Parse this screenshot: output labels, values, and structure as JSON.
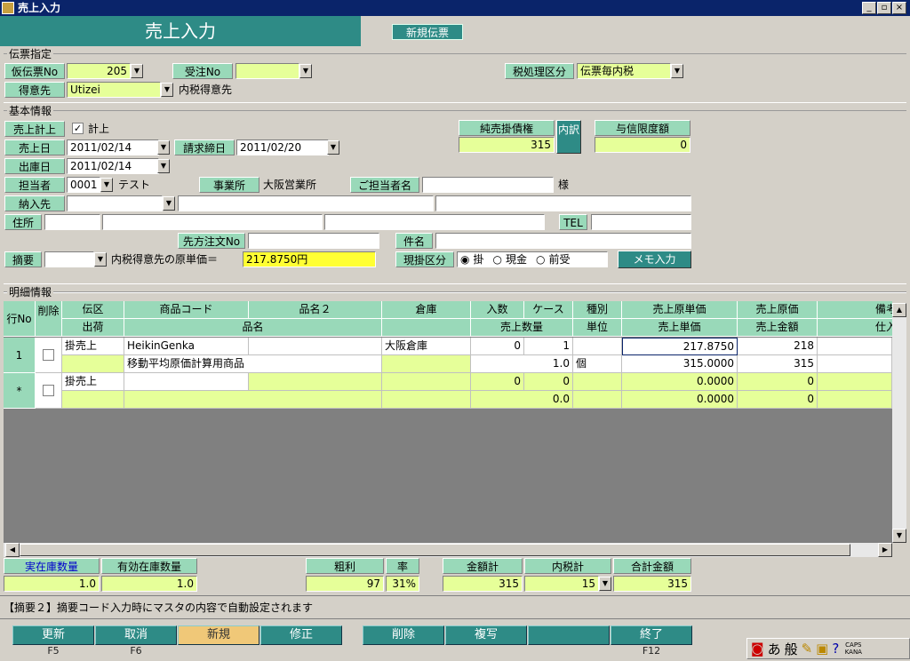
{
  "window": {
    "title": "売上入力"
  },
  "header": {
    "title": "売上入力",
    "badge": "新規伝票"
  },
  "denpyo": {
    "group_label": "伝票指定",
    "kari_no_label": "仮伝票No",
    "kari_no_value": "205",
    "juchu_no_label": "受注No",
    "juchu_no_value": "",
    "tax_label": "税処理区分",
    "tax_value": "伝票毎内税",
    "tokuisaki_label": "得意先",
    "tokuisaki_value": "Utizei",
    "tokuisaki_name": "内税得意先"
  },
  "kihon": {
    "group_label": "基本情報",
    "keijo_label": "売上計上",
    "keijo_check_label": "計上",
    "uriage_date_label": "売上日",
    "uriage_date": "2011/02/14",
    "seikyu_label": "請求締日",
    "seikyu_date": "2011/02/20",
    "shukko_label": "出庫日",
    "shukko_date": "2011/02/14",
    "tanto_label": "担当者",
    "tanto_code": "0001",
    "tanto_name": "テスト",
    "jigyosho_label": "事業所",
    "jigyosho_value": "大阪営業所",
    "gotanto_label": "ご担当者名",
    "gotanto_value": "",
    "sama": "様",
    "nonyu_label": "納入先",
    "jusho_label": "住所",
    "tel_label": "TEL",
    "sakichumon_label": "先方注文No",
    "kenmei_label": "件名",
    "tekiyo_label": "摘要",
    "tekiyo_text": "内税得意先の原単価＝",
    "tekiyo_value": "217.8750円",
    "genkake_label": "現掛区分",
    "radio_kake": "掛",
    "radio_genkin": "現金",
    "radio_maeuke": "前受",
    "memo_button": "メモ入力",
    "junuri_label": "純売掛債権",
    "junuri_value": "315",
    "uchiwake_button": "内訳",
    "yoshin_label": "与信限度額",
    "yoshin_value": "0"
  },
  "meisai": {
    "group_label": "明細情報",
    "headers_top": [
      "行No",
      "削除",
      "伝区",
      "商品コード",
      "品名２",
      "倉庫",
      "入数",
      "ケース",
      "種別",
      "売上原単価",
      "売上原価",
      "備考"
    ],
    "headers_bottom": [
      "出荷",
      "品名",
      "売上数量",
      "単位",
      "売上単価",
      "売上金額",
      "仕入"
    ],
    "rows": [
      {
        "no": "1",
        "denku": "掛売上",
        "code": "HeikinGenka",
        "hinmei2": "",
        "soko": "大阪倉庫",
        "irisu": "0",
        "case": "1",
        "shubetsu": "",
        "gentanka": "217.8750",
        "genka": "218",
        "hinmei": "移動平均原価計算用商品",
        "suryo": "1.0",
        "tani": "個",
        "tanka": "315.0000",
        "kingaku": "315"
      },
      {
        "no": "*",
        "denku": "掛売上",
        "code": "",
        "hinmei2": "",
        "soko": "",
        "irisu": "0",
        "case": "0",
        "shubetsu": "",
        "gentanka": "0.0000",
        "genka": "0",
        "hinmei": "",
        "suryo": "0.0",
        "tani": "",
        "tanka": "0.0000",
        "kingaku": "0"
      }
    ]
  },
  "totals": {
    "jitsuzaiko_label": "実在庫数量",
    "jitsuzaiko_value": "1.0",
    "yukozaiko_label": "有効在庫数量",
    "yukozaiko_value": "1.0",
    "arari_label": "粗利",
    "arari_value": "97",
    "ritsu_label": "率",
    "ritsu_value": "31%",
    "kingakukei_label": "金額計",
    "kingakukei_value": "315",
    "uchizei_label": "内税計",
    "uchizei_value": "15",
    "gokei_label": "合計金額",
    "gokei_value": "315"
  },
  "status": {
    "message": "【摘要２】摘要コード入力時にマスタの内容で自動設定されます"
  },
  "fkeys": [
    {
      "label": "更新",
      "key": "F5"
    },
    {
      "label": "取消",
      "key": "F6"
    },
    {
      "label": "新規",
      "key": ""
    },
    {
      "label": "修正",
      "key": ""
    },
    {
      "label": "削除",
      "key": ""
    },
    {
      "label": "複写",
      "key": ""
    },
    {
      "label": "",
      "key": ""
    },
    {
      "label": "終了",
      "key": "F12"
    }
  ],
  "ime": {
    "mode": "あ",
    "kind": "般",
    "caps": "CAPS",
    "kana": "KANA"
  },
  "colors": {
    "teal": "#2e8b86",
    "label_green": "#99d9b9",
    "input_yellow": "#e6ff99",
    "highlight_yellow": "#ffff33"
  }
}
